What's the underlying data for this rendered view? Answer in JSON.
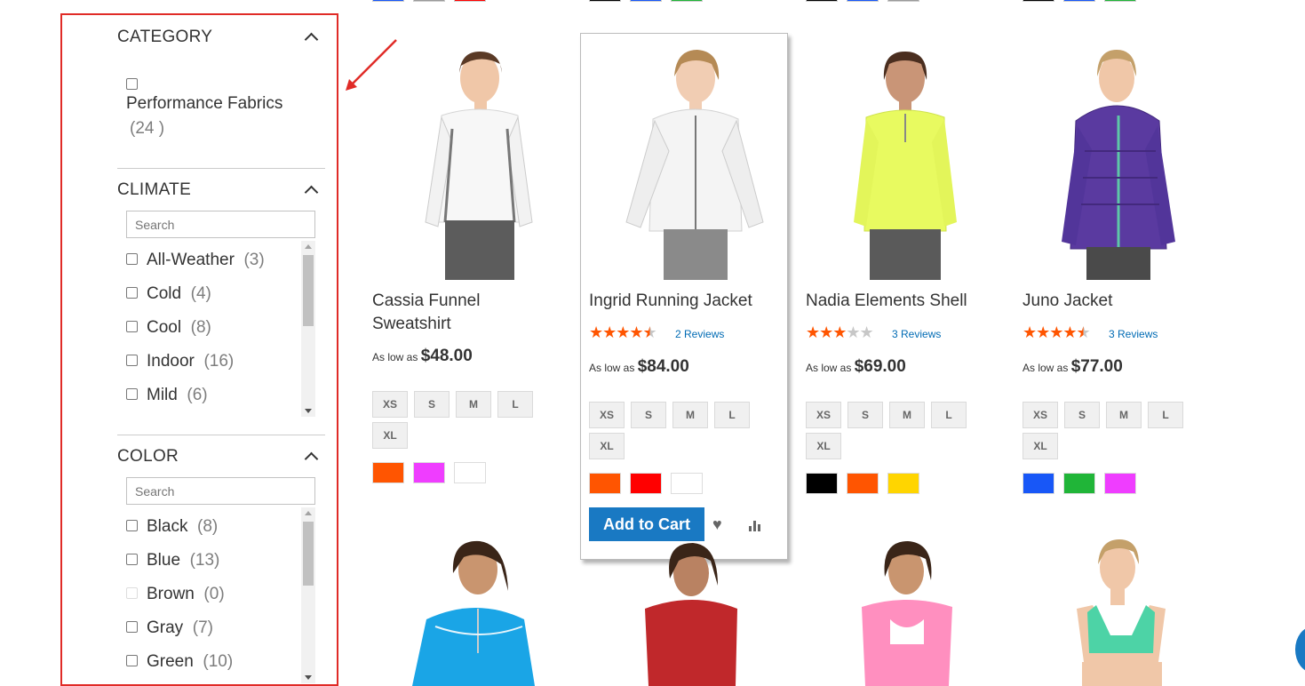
{
  "sidebar": {
    "category": {
      "title": "CATEGORY",
      "option_label": "Performance Fabrics",
      "option_count": "(24 )"
    },
    "climate": {
      "title": "CLIMATE",
      "search_placeholder": "Search",
      "options": [
        {
          "label": "All-Weather",
          "count": "(3)"
        },
        {
          "label": "Cold",
          "count": "(4)"
        },
        {
          "label": "Cool",
          "count": "(8)"
        },
        {
          "label": "Indoor",
          "count": "(16)"
        },
        {
          "label": "Mild",
          "count": "(6)"
        }
      ]
    },
    "color": {
      "title": "COLOR",
      "search_placeholder": "Search",
      "options": [
        {
          "label": "Black",
          "count": "(8)"
        },
        {
          "label": "Blue",
          "count": "(13)"
        },
        {
          "label": "Brown",
          "count": "(0)"
        },
        {
          "label": "Gray",
          "count": "(7)"
        },
        {
          "label": "Green",
          "count": "(10)"
        }
      ]
    }
  },
  "products": [
    {
      "name": "Cassia Funnel Sweatshirt",
      "price_prefix": "As low as",
      "price": "$48.00",
      "sizes": [
        "XS",
        "S",
        "M",
        "L",
        "XL"
      ],
      "swatches": [
        "#ff5501",
        "#ef3dff",
        "#ffffff"
      ]
    },
    {
      "name": "Ingrid Running Jacket",
      "rating": 4.5,
      "reviews": "2  Reviews",
      "price_prefix": "As low as",
      "price": "$84.00",
      "sizes": [
        "XS",
        "S",
        "M",
        "L",
        "XL"
      ],
      "swatches": [
        "#ff5501",
        "#ff0000",
        "#ffffff"
      ],
      "add_to_cart": "Add to Cart"
    },
    {
      "name": "Nadia Elements Shell",
      "rating": 3,
      "reviews": "3  Reviews",
      "price_prefix": "As low as",
      "price": "$69.00",
      "sizes": [
        "XS",
        "S",
        "M",
        "L",
        "XL"
      ],
      "swatches": [
        "#000000",
        "#ff5501",
        "#ffd500"
      ]
    },
    {
      "name": "Juno Jacket",
      "rating": 4.5,
      "reviews": "3  Reviews",
      "price_prefix": "As low as",
      "price": "$77.00",
      "sizes": [
        "XS",
        "S",
        "M",
        "L",
        "XL"
      ],
      "swatches": [
        "#1857f7",
        "#20b538",
        "#ef3dff"
      ]
    }
  ],
  "colors": {
    "accent": "#1979c3",
    "star": "#ff5501",
    "annotation": "#e02b27"
  }
}
